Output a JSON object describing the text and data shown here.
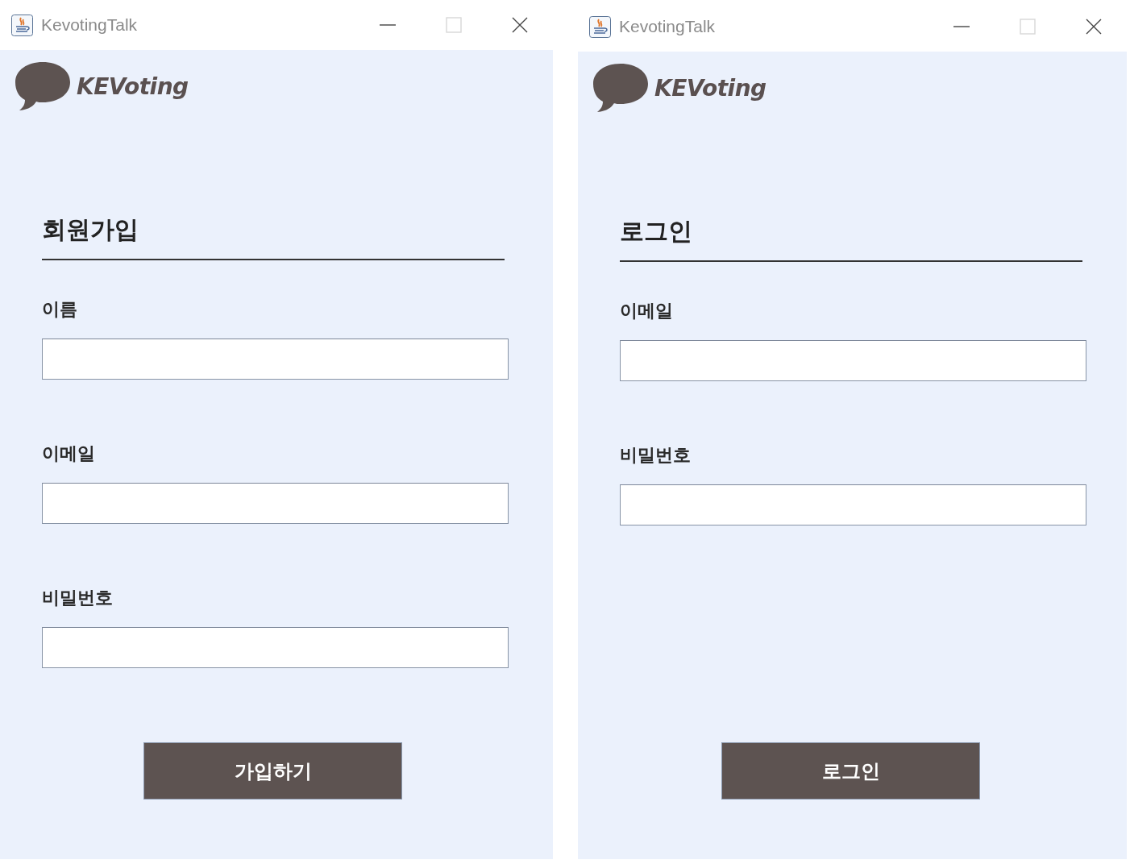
{
  "windows": [
    {
      "title": "KevotingTalk",
      "maximize_disabled": true,
      "logo": "KEVoting",
      "heading": "회원가입",
      "fields": [
        {
          "label": "이름"
        },
        {
          "label": "이메일"
        },
        {
          "label": "비밀번호"
        }
      ],
      "button": "가입하기"
    },
    {
      "title": "KevotingTalk",
      "maximize_disabled": true,
      "logo": "KEVoting",
      "heading": "로그인",
      "fields": [
        {
          "label": "이메일"
        },
        {
          "label": "비밀번호"
        }
      ],
      "button": "로그인"
    }
  ]
}
